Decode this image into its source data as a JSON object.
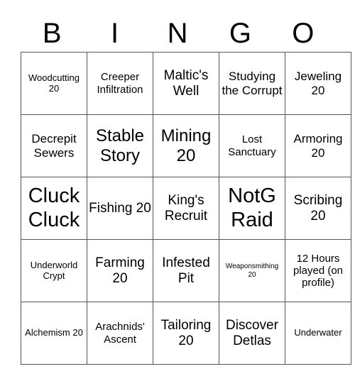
{
  "header": {
    "letters": [
      "B",
      "I",
      "N",
      "G",
      "O"
    ]
  },
  "grid": {
    "rows": [
      [
        "Woodcutting 20",
        "Creeper Infiltration",
        "Maltic's Well",
        "Studying the Corrupt",
        "Jeweling 20"
      ],
      [
        "Decrepit Sewers",
        "Stable Story",
        "Mining 20",
        "Lost Sanctuary",
        "Armoring 20"
      ],
      [
        "Cluck Cluck",
        "Fishing 20",
        "King's Recruit",
        "NotG Raid",
        "Scribing 20"
      ],
      [
        "Underworld Crypt",
        "Farming 20",
        "Infested Pit",
        "Weaponsmithing 20",
        "12 Hours played (on profile)"
      ],
      [
        "Alchemism 20",
        "Arachnids' Ascent",
        "Tailoring 20",
        "Discover Detlas",
        "Underwater"
      ]
    ]
  }
}
